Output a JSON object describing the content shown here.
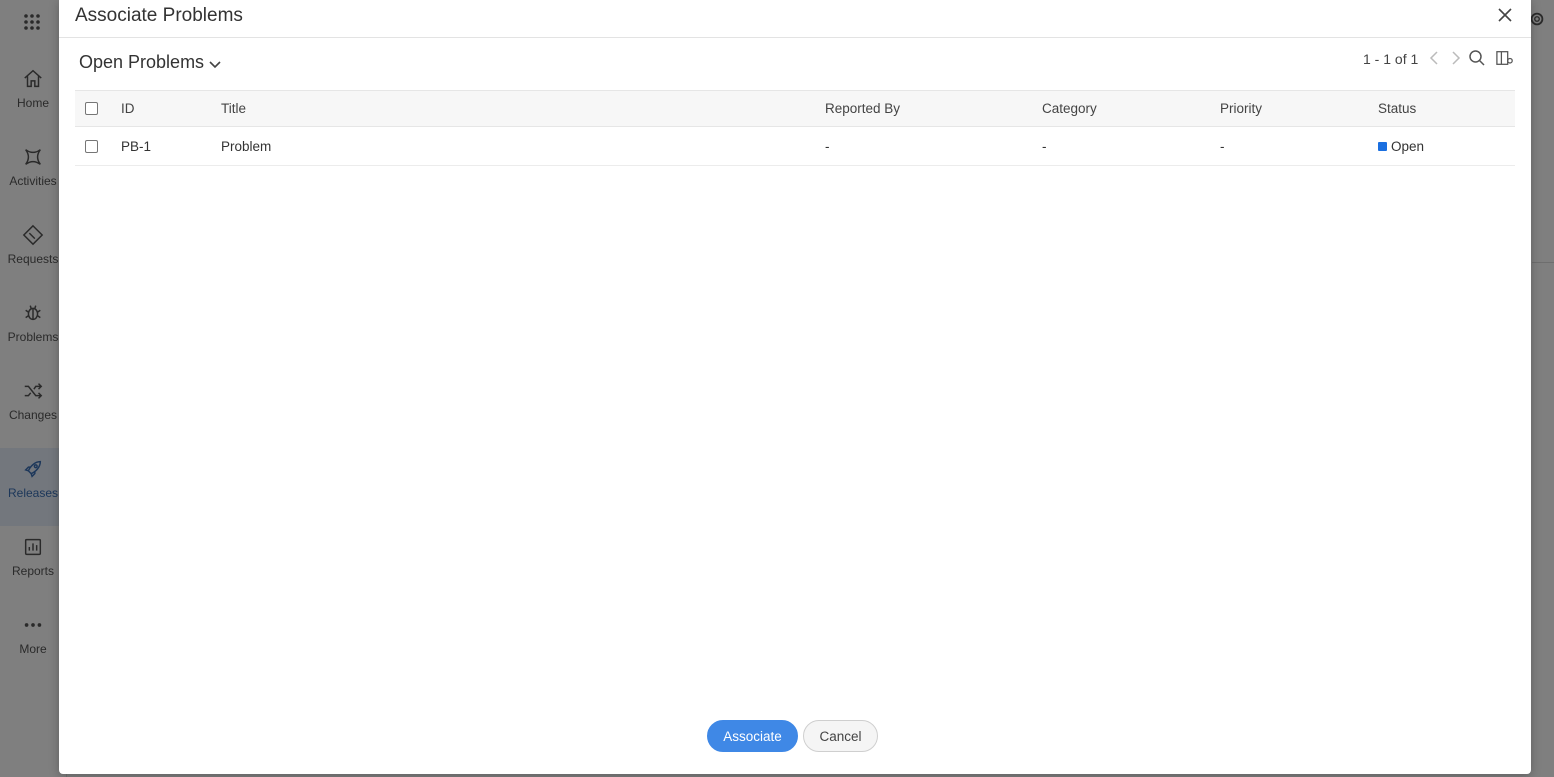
{
  "sidebar": {
    "items": [
      {
        "label": "Home",
        "icon": "home-icon"
      },
      {
        "label": "Activities",
        "icon": "activities-icon"
      },
      {
        "label": "Requests",
        "icon": "ticket-icon"
      },
      {
        "label": "Problems",
        "icon": "bug-icon"
      },
      {
        "label": "Changes",
        "icon": "shuffle-icon"
      },
      {
        "label": "Releases",
        "icon": "rocket-icon",
        "active": true
      },
      {
        "label": "Reports",
        "icon": "bar-chart-icon"
      },
      {
        "label": "More",
        "icon": "more-dots-icon"
      }
    ]
  },
  "modal": {
    "title": "Associate Problems",
    "view_selector": "Open Problems",
    "pagination": "1 - 1 of 1",
    "table": {
      "columns": [
        "ID",
        "Title",
        "Reported By",
        "Category",
        "Priority",
        "Status"
      ],
      "rows": [
        {
          "id": "PB-1",
          "title": "Problem",
          "reported_by": "-",
          "category": "-",
          "priority": "-",
          "status": "Open"
        }
      ]
    },
    "buttons": {
      "associate": "Associate",
      "cancel": "Cancel"
    }
  },
  "colors": {
    "accent": "#3f88e6",
    "status_open": "#1a6fe0",
    "overlay": "rgba(0,0,0,0.5)"
  }
}
